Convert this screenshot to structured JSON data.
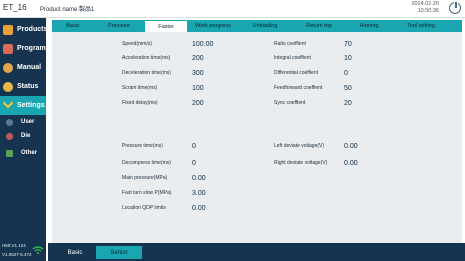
{
  "header": {
    "device_id": "ET_16",
    "product_name": "Product name:製品1",
    "date": "2024.02.20",
    "time": "10:50:36"
  },
  "sidebar": {
    "items": [
      {
        "label": "Products",
        "icon": "products-icon"
      },
      {
        "label": "Program",
        "icon": "program-icon"
      },
      {
        "label": "Manual",
        "icon": "manual-icon"
      },
      {
        "label": "Status",
        "icon": "status-icon"
      },
      {
        "label": "Settings",
        "icon": "settings-icon"
      }
    ],
    "sub_items": [
      {
        "label": "User",
        "icon": "user-icon"
      },
      {
        "label": "Die",
        "icon": "die-icon"
      },
      {
        "label": "Other",
        "icon": "other-icon"
      }
    ],
    "version1": "HMI:V1.124",
    "version2": "V1.0627-5.474"
  },
  "tabs": [
    "Basic",
    "Pressure",
    "Faster",
    "Work progress",
    "Unloading",
    "Return trip",
    "Homing",
    "Tool setting"
  ],
  "active_tab": "Faster",
  "left_params": [
    {
      "label": "Speed(mm/s)",
      "value": "100.00"
    },
    {
      "label": "Acceleration time(ms)",
      "value": "200"
    },
    {
      "label": "Deceleration time(ms)",
      "value": "300"
    },
    {
      "label": "Scram time(ms)",
      "value": "100"
    },
    {
      "label": "Fixed delay(ms)",
      "value": "200"
    }
  ],
  "right_params": [
    {
      "label": "Ratio coeffient",
      "value": "70"
    },
    {
      "label": "Integral coeffient",
      "value": "10"
    },
    {
      "label": "Differential coeffient",
      "value": "0"
    },
    {
      "label": "Feedforward coeffient",
      "value": "50"
    },
    {
      "label": "Sync coeffient",
      "value": "20"
    }
  ],
  "left_params2": [
    {
      "label": "Pressure time(ms)",
      "value": "0"
    },
    {
      "label": "Decompress time(ms)",
      "value": "0"
    },
    {
      "label": "Main pressure(MPa)",
      "value": "0.00"
    },
    {
      "label": "Fast turn slow P(MPa)",
      "value": "3.00"
    },
    {
      "label": "Location QDP limits",
      "value": "0.00"
    }
  ],
  "right_params2": [
    {
      "label": "Left deviate voltage(V)",
      "value": "0.00"
    },
    {
      "label": "Right deviate voltage(V)",
      "value": "0.00"
    }
  ],
  "bottom_tabs": [
    "Basic",
    "Senior"
  ],
  "colors": {
    "navy": "#16344f",
    "teal": "#1aa6b0",
    "panel": "#e9edf0"
  }
}
